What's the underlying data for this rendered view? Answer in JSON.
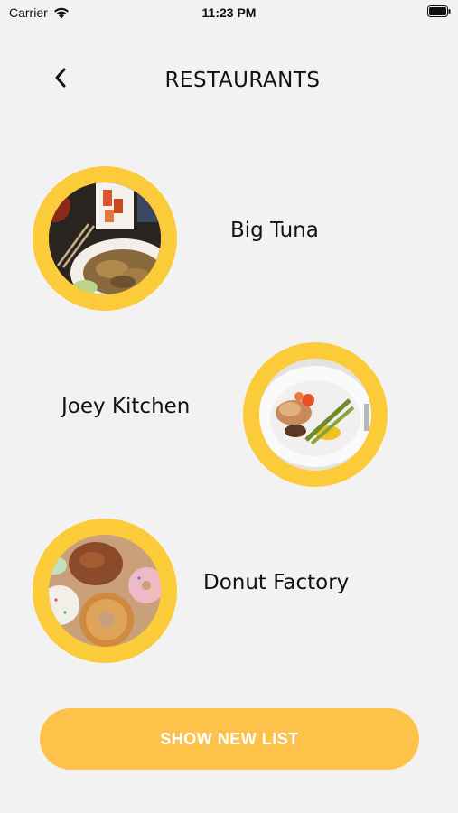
{
  "status_bar": {
    "carrier": "Carrier",
    "time": "11:23 PM"
  },
  "header": {
    "title": "RESTAURANTS"
  },
  "restaurants": [
    {
      "name": "Big Tuna",
      "image": "sushi-and-chicken-plate"
    },
    {
      "name": "Joey Kitchen",
      "image": "fish-with-asparagus-plate"
    },
    {
      "name": "Donut Factory",
      "image": "assorted-donuts"
    }
  ],
  "actions": {
    "show_new_list": "SHOW NEW LIST"
  },
  "colors": {
    "background": "#f2f2f2",
    "ring": "#fccb3a",
    "button": "#fdc24a",
    "button_text": "#ffffff"
  }
}
